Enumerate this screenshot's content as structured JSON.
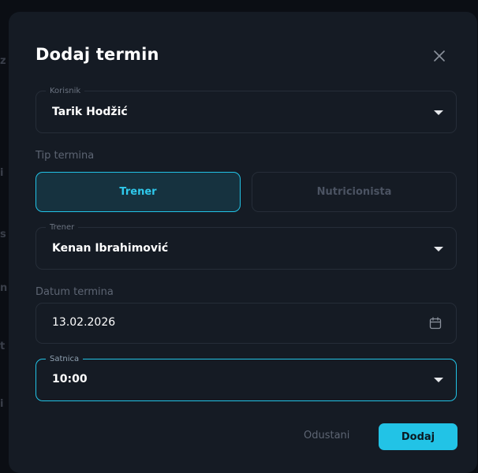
{
  "dialog": {
    "title": "Dodaj termin",
    "close_icon": "close-icon"
  },
  "user_select": {
    "legend": "Korisnik",
    "value": "Tarik Hodžić"
  },
  "appointment_type": {
    "label": "Tip termina",
    "options": [
      "Trener",
      "Nutricionista"
    ],
    "selected": "Trener"
  },
  "trainer_select": {
    "legend": "Trener",
    "value": "Kenan Ibrahimović"
  },
  "date": {
    "label": "Datum termina",
    "value": "13.02.2026",
    "icon": "calendar-icon"
  },
  "time_select": {
    "legend": "Satnica",
    "value": "10:00"
  },
  "actions": {
    "cancel_label": "Odustani",
    "submit_label": "Dodaj"
  },
  "colors": {
    "accent": "#22c3e6",
    "dialog_bg": "#151b24",
    "backdrop": "#0b0e14"
  }
}
